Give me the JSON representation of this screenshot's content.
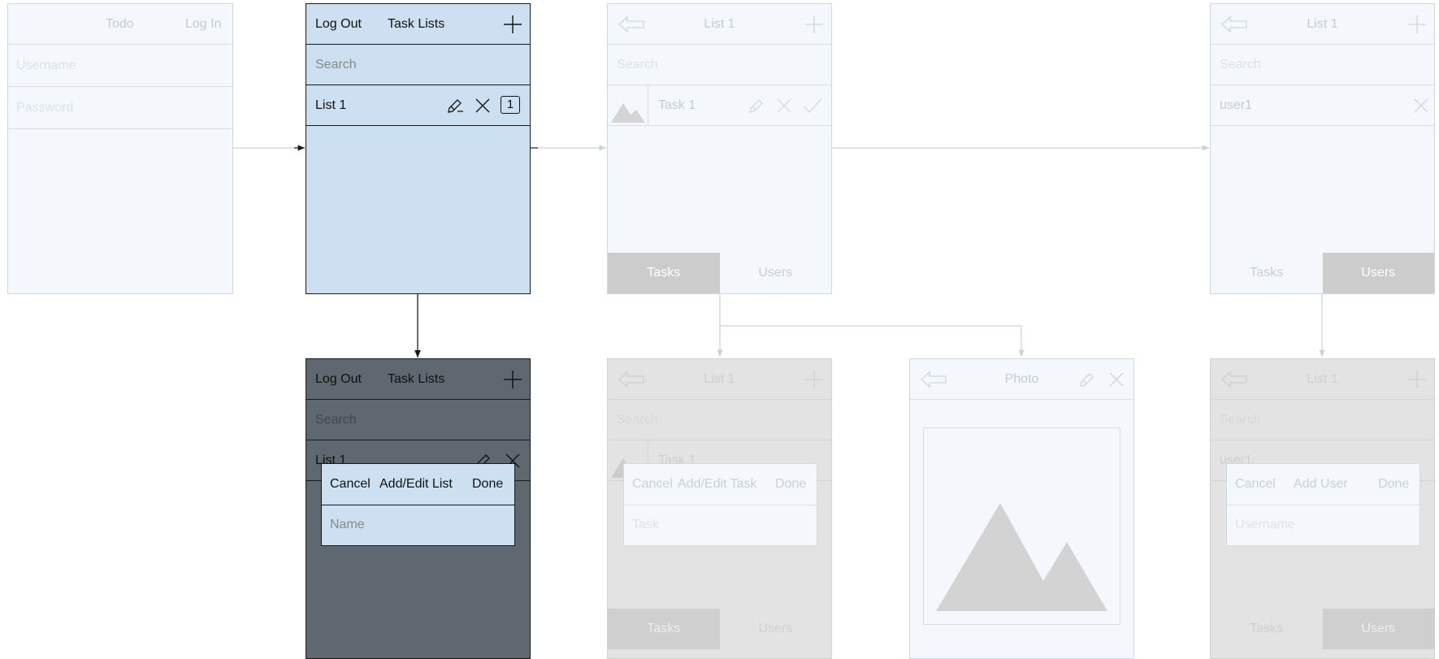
{
  "login": {
    "title": "Todo",
    "login_label": "Log In",
    "username_placeholder": "Username",
    "password_placeholder": "Password"
  },
  "task_lists": {
    "logout_label": "Log Out",
    "title": "Task Lists",
    "search_placeholder": "Search",
    "list_name": "List 1",
    "list_count": "1"
  },
  "list_detail": {
    "title": "List 1",
    "search_placeholder": "Search",
    "task_name": "Task 1",
    "tab_tasks": "Tasks",
    "tab_users": "Users"
  },
  "users_view": {
    "title": "List 1",
    "search_placeholder": "Search",
    "user_name": "user1",
    "tab_tasks": "Tasks",
    "tab_users": "Users"
  },
  "add_edit_list_dialog": {
    "logout_label": "Log Out",
    "title": "Task Lists",
    "search_placeholder": "Search",
    "list_name": "List 1",
    "cancel_label": "Cancel",
    "dialog_title": "Add/Edit List",
    "done_label": "Done",
    "name_placeholder": "Name"
  },
  "add_edit_task_dialog": {
    "title": "List 1",
    "search_placeholder": "Search",
    "task_name": "Task 1",
    "cancel_label": "Cancel",
    "dialog_title": "Add/Edit Task",
    "done_label": "Done",
    "task_placeholder": "Task",
    "tab_tasks": "Tasks",
    "tab_users": "Users"
  },
  "photo_view": {
    "title": "Photo"
  },
  "add_user_dialog": {
    "title": "List 1",
    "search_placeholder": "Search",
    "user_name": "user1",
    "cancel_label": "Cancel",
    "dialog_title": "Add User",
    "done_label": "Done",
    "username_placeholder": "Username",
    "tab_tasks": "Tasks",
    "tab_users": "Users"
  },
  "colors": {
    "active_fill": "#cde0f1",
    "overlay_dark": "#5f6870",
    "faded_fill": "#f4f8fc",
    "selected_tab": "#cccccc"
  }
}
